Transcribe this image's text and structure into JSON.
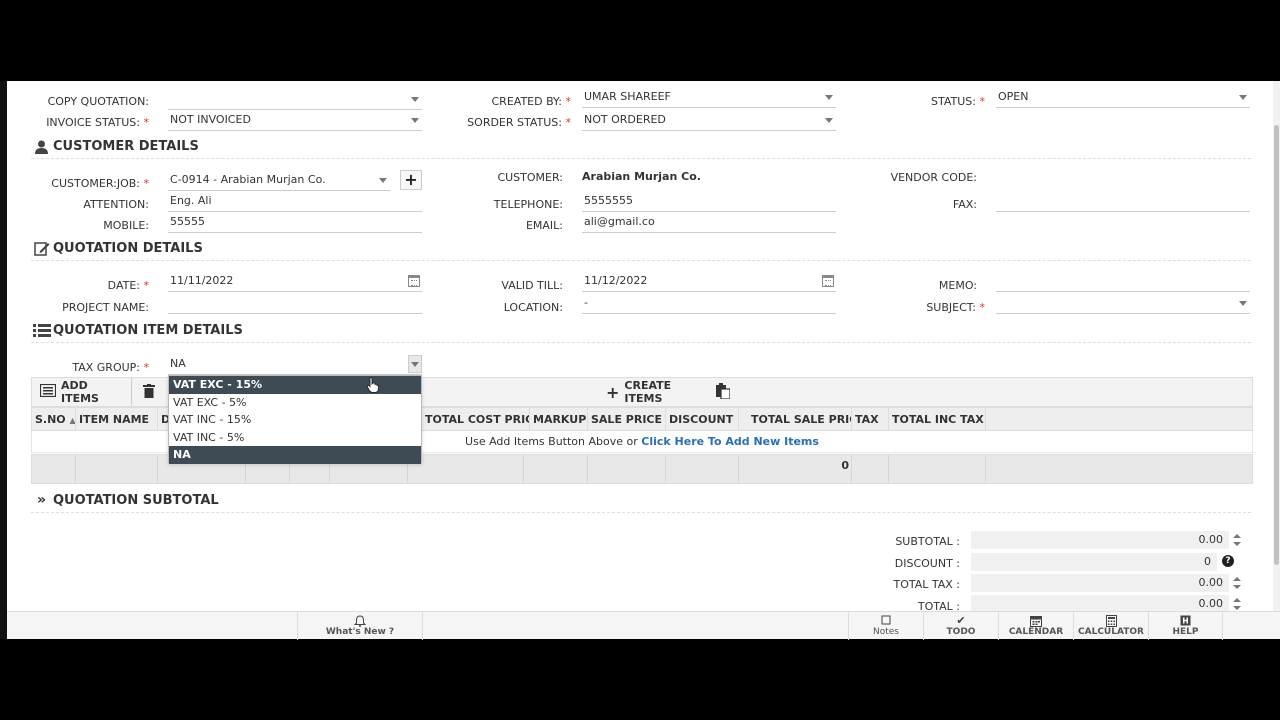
{
  "top": {
    "copy_quotation_label": "COPY QUOTATION:",
    "invoice_status_label": "INVOICE STATUS:",
    "invoice_status_value": "NOT INVOICED",
    "created_by_label": "CREATED BY:",
    "created_by_value": "UMAR SHAREEF",
    "sorder_status_label": "SORDER STATUS:",
    "sorder_status_value": "NOT ORDERED",
    "status_label": "STATUS:",
    "status_value": "OPEN",
    "required_mark": "*"
  },
  "customer": {
    "section_title": "CUSTOMER DETAILS",
    "customer_job_label": "CUSTOMER:JOB:",
    "customer_job_value": "C-0914 - Arabian Murjan Co.",
    "attention_label": "ATTENTION:",
    "attention_value": "Eng. Ali",
    "mobile_label": "MOBILE:",
    "mobile_value": "55555",
    "customer_label": "CUSTOMER:",
    "customer_value": "Arabian Murjan Co.",
    "telephone_label": "TELEPHONE:",
    "telephone_value": "5555555",
    "email_label": "EMAIL:",
    "email_value": "ali@gmail.co",
    "vendor_code_label": "VENDOR CODE:",
    "fax_label": "FAX:"
  },
  "quotation": {
    "section_title": "QUOTATION DETAILS",
    "date_label": "DATE:",
    "date_value": "11/11/2022",
    "project_name_label": "PROJECT NAME:",
    "valid_till_label": "VALID TILL:",
    "valid_till_value": "11/12/2022",
    "location_label": "LOCATION:",
    "location_value": "-",
    "memo_label": "MEMO:",
    "subject_label": "SUBJECT:"
  },
  "items": {
    "section_title": "QUOTATION ITEM DETAILS",
    "tax_group_label": "TAX GROUP:",
    "tax_group_value": "NA",
    "tax_options": [
      "VAT EXC - 15%",
      "VAT EXC - 5%",
      "VAT INC - 15%",
      "VAT INC - 5%",
      "NA"
    ],
    "add_items_label": "ADD ITEMS",
    "create_items_label": "CREATE ITEMS",
    "columns": [
      "S.NO",
      "ITEM NAME",
      "DE",
      "TOTAL COST PRICE",
      "MARKUP",
      "SALE PRICE",
      "DISCOUNT",
      "TOTAL SALE PRICE",
      "TAX",
      "TOTAL INC TAX"
    ],
    "empty_text": "Use Add Items Button Above or ",
    "empty_link": "Click Here To Add New Items",
    "footer_total": "0"
  },
  "subtotal": {
    "section_title": "QUOTATION SUBTOTAL",
    "subtotal_label": "SUBTOTAL :",
    "subtotal_value": "0.00",
    "discount_label": "DISCOUNT :",
    "discount_value": "0",
    "total_tax_label": "TOTAL TAX :",
    "total_tax_value": "0.00",
    "total_label": "TOTAL :",
    "total_value": "0.00"
  },
  "bottombar": {
    "whats_new": "What's New ?",
    "notes": "Notes",
    "todo": "TODO",
    "calendar": "CALENDAR",
    "calculator": "CALCULATOR",
    "help": "HELP"
  },
  "colors": {
    "required": "#d9322e",
    "link": "#2a6fb0",
    "selected_option_bg": "#3e4a54"
  }
}
